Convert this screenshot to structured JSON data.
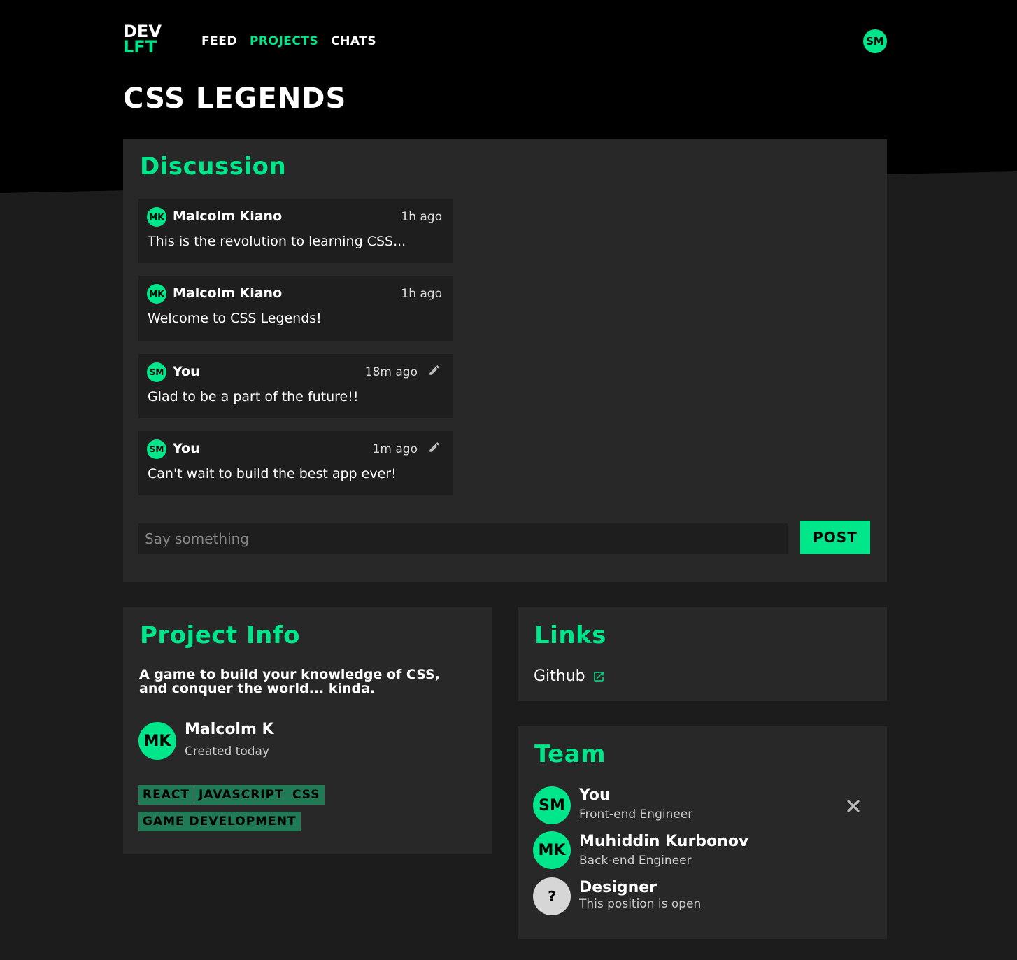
{
  "brand": {
    "line1": "DEV",
    "line2": "LFT"
  },
  "nav": {
    "feed": "FEED",
    "projects": "PROJECTS",
    "chats": "CHATS"
  },
  "user": {
    "initials": "SM"
  },
  "page": {
    "title": "CSS LEGENDS"
  },
  "colors": {
    "accent": "#00e68a",
    "tag_bg": "#1f7a55",
    "card": "#282828"
  },
  "discussion": {
    "title": "Discussion",
    "messages": [
      {
        "initials": "MK",
        "author": "Malcolm Kiano",
        "time": "1h ago",
        "text": "This is the revolution to learning CSS...",
        "editable": false
      },
      {
        "initials": "MK",
        "author": "Malcolm Kiano",
        "time": "1h ago",
        "text": "Welcome to CSS Legends!",
        "editable": false
      },
      {
        "initials": "SM",
        "author": "You",
        "time": "18m ago",
        "text": "Glad to be a part of the future!!",
        "editable": true
      },
      {
        "initials": "SM",
        "author": "You",
        "time": "1m ago",
        "text": "Can't wait to build the best app ever!",
        "editable": true
      }
    ],
    "input_placeholder": "Say something",
    "post_label": "POST"
  },
  "project_info": {
    "title": "Project Info",
    "description": "A game to build your knowledge of CSS, and conquer the world... kinda.",
    "creator": {
      "initials": "MK",
      "name": "Malcolm K",
      "created": "Created today"
    },
    "tags": [
      "REACT",
      "JAVASCRIPT",
      "CSS",
      "GAME DEVELOPMENT"
    ]
  },
  "links": {
    "title": "Links",
    "github": "Github",
    "icon": "external-link-icon"
  },
  "team": {
    "title": "Team",
    "members": [
      {
        "initials": "SM",
        "name": "You",
        "role": "Front-end Engineer"
      },
      {
        "initials": "MK",
        "name": "Muhiddin Kurbonov",
        "role": "Back-end Engineer"
      },
      {
        "initials": "?",
        "name": "Designer",
        "role": "This position is open"
      }
    ]
  }
}
